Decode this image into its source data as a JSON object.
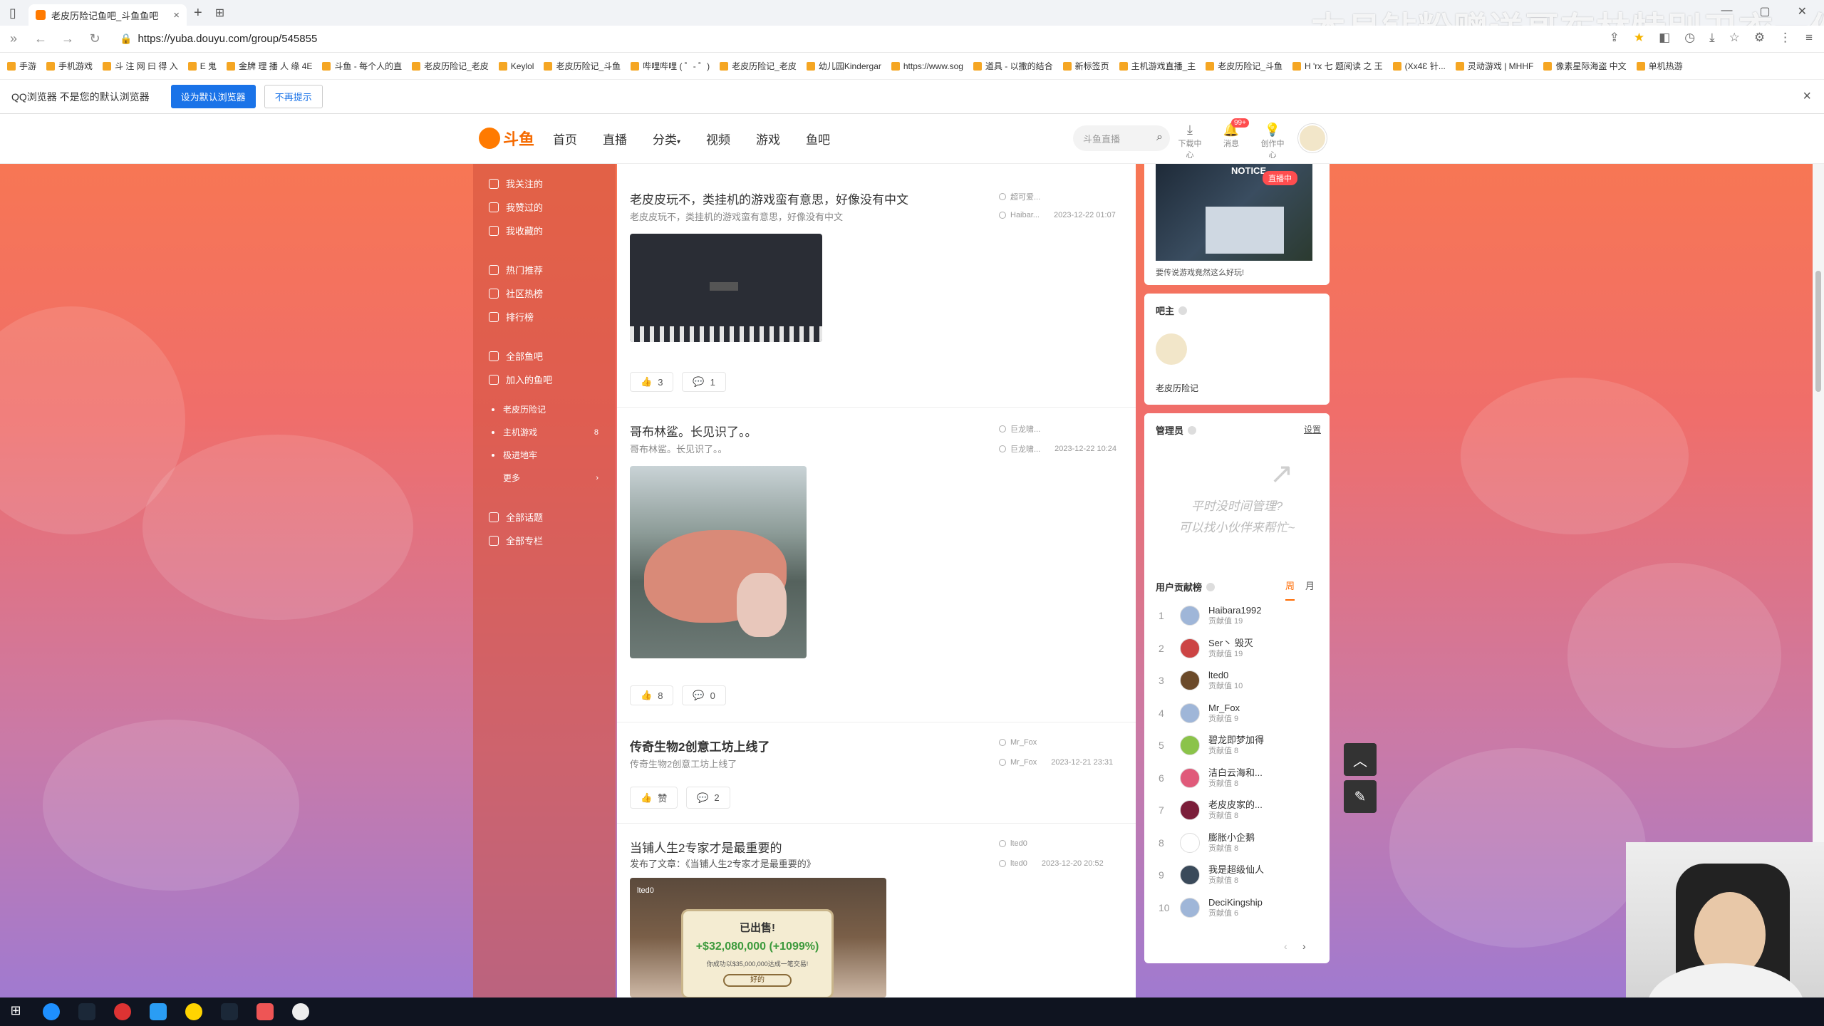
{
  "browser": {
    "tab_title": "老皮历险记鱼吧_斗鱼鱼吧",
    "url": "https://yuba.douyu.com/group/545855",
    "bookmarks": [
      "手游",
      "手机游戏",
      "斗 注 网 曰 得 入",
      "E 鬼",
      "金牌 理 播 人 缘 4E",
      "斗鱼 - 每个人的直",
      "老皮历险记_老皮",
      "Keylol",
      "老皮历险记_斗鱼",
      "哔哩哔哩 ( ゜- ゜)",
      "老皮历险记_老皮",
      "幼儿园Kindergar",
      "https://www.sog",
      "道具 - 以撒的结合",
      "新标签页",
      "主机游戏直播_主",
      "老皮历险记_斗鱼",
      "H 'rx 七 题阅读 之 王",
      "(Xx4Ɛ 针...",
      "灵动游戏 | MHHF",
      "像素星际海盗 中文",
      "单机热游"
    ],
    "infobar_text": "QQ浏览器 不是您的默认浏览器",
    "infobar_set_default": "设为默认浏览器",
    "infobar_dismiss": "不再提示"
  },
  "overlay": {
    "text": "本月钻粉赠送哥布林特别卫衣一件"
  },
  "site": {
    "logo_text": "斗鱼",
    "nav": [
      "首页",
      "直播",
      "分类",
      "视频",
      "游戏",
      "鱼吧"
    ],
    "search_placeholder": "斗鱼直播",
    "header_icons": [
      {
        "name": "download",
        "label": "下载中心"
      },
      {
        "name": "message",
        "label": "消息",
        "badge": "99+"
      },
      {
        "name": "creator",
        "label": "创作中心"
      }
    ]
  },
  "sidebar": {
    "group1": [
      "我关注的",
      "我赞过的",
      "我收藏的"
    ],
    "group2": [
      "热门推荐",
      "社区热榜",
      "排行榜"
    ],
    "group3": [
      "全部鱼吧",
      "加入的鱼吧"
    ],
    "joined": [
      {
        "label": "老皮历险记",
        "count": ""
      },
      {
        "label": "主机游戏",
        "count": "8"
      },
      {
        "label": "极进地牢",
        "count": ""
      }
    ],
    "more": "更多",
    "group4": [
      "全部话题",
      "全部专栏"
    ]
  },
  "feed": {
    "posts": [
      {
        "title": "老皮皮玩不，类挂机的游戏蛮有意思，好像没有中文",
        "summary": "老皮皮玩不，类挂机的游戏蛮有意思，好像没有中文",
        "author": "超可爱...",
        "replier": "Haibar...",
        "date": "2023-12-22 01:07",
        "likes": "3",
        "comments": "1"
      },
      {
        "title": "哥布林鲨。长见识了。。",
        "summary": "哥布林鲨。长见识了。。",
        "author": "巨龙啸...",
        "replier": "巨龙啸...",
        "date": "2023-12-22 10:24",
        "likes": "8",
        "comments": "0"
      },
      {
        "title": "传奇生物2创意工坊上线了",
        "summary": "传奇生物2创意工坊上线了",
        "author": "Mr_Fox",
        "replier": "Mr_Fox",
        "date": "2023-12-21 23:31",
        "likes": "赞",
        "comments": "2"
      },
      {
        "title": "当铺人生2专家才是最重要的",
        "summary": "发布了文章：《当铺人生2专家才是最重要的》",
        "author": "lted0",
        "replier": "lted0",
        "date": "2023-12-20 20:52",
        "img_user": "lted0",
        "img_sold": "已出售!",
        "img_price": "+$32,080,000 (+1099%)",
        "img_sub": "你成功以$35,000,000达成一笔交易!",
        "img_btn": "好的"
      }
    ]
  },
  "right": {
    "live_badge": "直播中",
    "notice": "NOTICE",
    "live_caption": "要传说游戏竟然这么好玩!",
    "owner_title": "吧主",
    "owner_name": "老皮历险记",
    "admin_title": "管理员",
    "admin_settings": "设置",
    "admin_empty_line1": "平时没时间管理?",
    "admin_empty_line2": "可以找小伙伴来帮忙~",
    "rank_title": "用户贡献榜",
    "rank_tabs": [
      "周",
      "月"
    ],
    "rank": [
      {
        "n": "1",
        "name": "Haibara1992",
        "score": "贡献值 19",
        "color": "#9fb6d8"
      },
      {
        "n": "2",
        "name": "Ser丶 毁灭",
        "score": "贡献值 19",
        "color": "#c44"
      },
      {
        "n": "3",
        "name": "lted0",
        "score": "贡献值 10",
        "color": "#6b4a2a"
      },
      {
        "n": "4",
        "name": "Mr_Fox",
        "score": "贡献值 9",
        "color": "#9fb6d8"
      },
      {
        "n": "5",
        "name": "碧龙即梦加得",
        "score": "贡献值 8",
        "color": "#8bc34a"
      },
      {
        "n": "6",
        "name": "洁白云海和...",
        "score": "贡献值 8",
        "color": "#e05a7a"
      },
      {
        "n": "7",
        "name": "老皮皮家的...",
        "score": "贡献值 8",
        "color": "#7b1e3a"
      },
      {
        "n": "8",
        "name": "膨胀小企鹅",
        "score": "贡献值 8",
        "color": "#ffffff"
      },
      {
        "n": "9",
        "name": "我是超级仙人",
        "score": "贡献值 8",
        "color": "#3a4a5a"
      },
      {
        "n": "10",
        "name": "DeciKingship",
        "score": "贡献值 6",
        "color": "#9fb6d8"
      }
    ]
  }
}
